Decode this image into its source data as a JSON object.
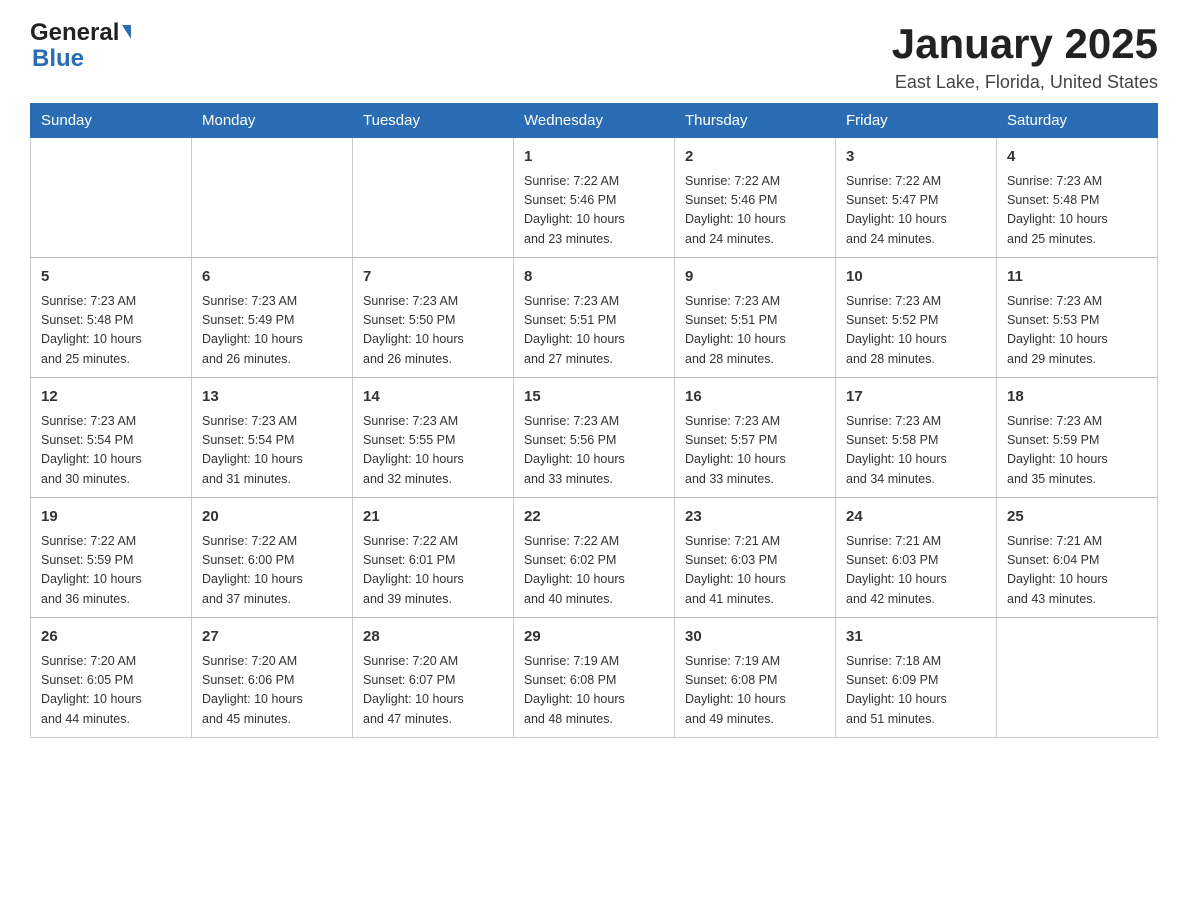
{
  "header": {
    "logo_general": "General",
    "logo_blue": "Blue",
    "month_title": "January 2025",
    "location": "East Lake, Florida, United States"
  },
  "weekdays": [
    "Sunday",
    "Monday",
    "Tuesday",
    "Wednesday",
    "Thursday",
    "Friday",
    "Saturday"
  ],
  "weeks": [
    [
      {
        "day": "",
        "info": ""
      },
      {
        "day": "",
        "info": ""
      },
      {
        "day": "",
        "info": ""
      },
      {
        "day": "1",
        "info": "Sunrise: 7:22 AM\nSunset: 5:46 PM\nDaylight: 10 hours\nand 23 minutes."
      },
      {
        "day": "2",
        "info": "Sunrise: 7:22 AM\nSunset: 5:46 PM\nDaylight: 10 hours\nand 24 minutes."
      },
      {
        "day": "3",
        "info": "Sunrise: 7:22 AM\nSunset: 5:47 PM\nDaylight: 10 hours\nand 24 minutes."
      },
      {
        "day": "4",
        "info": "Sunrise: 7:23 AM\nSunset: 5:48 PM\nDaylight: 10 hours\nand 25 minutes."
      }
    ],
    [
      {
        "day": "5",
        "info": "Sunrise: 7:23 AM\nSunset: 5:48 PM\nDaylight: 10 hours\nand 25 minutes."
      },
      {
        "day": "6",
        "info": "Sunrise: 7:23 AM\nSunset: 5:49 PM\nDaylight: 10 hours\nand 26 minutes."
      },
      {
        "day": "7",
        "info": "Sunrise: 7:23 AM\nSunset: 5:50 PM\nDaylight: 10 hours\nand 26 minutes."
      },
      {
        "day": "8",
        "info": "Sunrise: 7:23 AM\nSunset: 5:51 PM\nDaylight: 10 hours\nand 27 minutes."
      },
      {
        "day": "9",
        "info": "Sunrise: 7:23 AM\nSunset: 5:51 PM\nDaylight: 10 hours\nand 28 minutes."
      },
      {
        "day": "10",
        "info": "Sunrise: 7:23 AM\nSunset: 5:52 PM\nDaylight: 10 hours\nand 28 minutes."
      },
      {
        "day": "11",
        "info": "Sunrise: 7:23 AM\nSunset: 5:53 PM\nDaylight: 10 hours\nand 29 minutes."
      }
    ],
    [
      {
        "day": "12",
        "info": "Sunrise: 7:23 AM\nSunset: 5:54 PM\nDaylight: 10 hours\nand 30 minutes."
      },
      {
        "day": "13",
        "info": "Sunrise: 7:23 AM\nSunset: 5:54 PM\nDaylight: 10 hours\nand 31 minutes."
      },
      {
        "day": "14",
        "info": "Sunrise: 7:23 AM\nSunset: 5:55 PM\nDaylight: 10 hours\nand 32 minutes."
      },
      {
        "day": "15",
        "info": "Sunrise: 7:23 AM\nSunset: 5:56 PM\nDaylight: 10 hours\nand 33 minutes."
      },
      {
        "day": "16",
        "info": "Sunrise: 7:23 AM\nSunset: 5:57 PM\nDaylight: 10 hours\nand 33 minutes."
      },
      {
        "day": "17",
        "info": "Sunrise: 7:23 AM\nSunset: 5:58 PM\nDaylight: 10 hours\nand 34 minutes."
      },
      {
        "day": "18",
        "info": "Sunrise: 7:23 AM\nSunset: 5:59 PM\nDaylight: 10 hours\nand 35 minutes."
      }
    ],
    [
      {
        "day": "19",
        "info": "Sunrise: 7:22 AM\nSunset: 5:59 PM\nDaylight: 10 hours\nand 36 minutes."
      },
      {
        "day": "20",
        "info": "Sunrise: 7:22 AM\nSunset: 6:00 PM\nDaylight: 10 hours\nand 37 minutes."
      },
      {
        "day": "21",
        "info": "Sunrise: 7:22 AM\nSunset: 6:01 PM\nDaylight: 10 hours\nand 39 minutes."
      },
      {
        "day": "22",
        "info": "Sunrise: 7:22 AM\nSunset: 6:02 PM\nDaylight: 10 hours\nand 40 minutes."
      },
      {
        "day": "23",
        "info": "Sunrise: 7:21 AM\nSunset: 6:03 PM\nDaylight: 10 hours\nand 41 minutes."
      },
      {
        "day": "24",
        "info": "Sunrise: 7:21 AM\nSunset: 6:03 PM\nDaylight: 10 hours\nand 42 minutes."
      },
      {
        "day": "25",
        "info": "Sunrise: 7:21 AM\nSunset: 6:04 PM\nDaylight: 10 hours\nand 43 minutes."
      }
    ],
    [
      {
        "day": "26",
        "info": "Sunrise: 7:20 AM\nSunset: 6:05 PM\nDaylight: 10 hours\nand 44 minutes."
      },
      {
        "day": "27",
        "info": "Sunrise: 7:20 AM\nSunset: 6:06 PM\nDaylight: 10 hours\nand 45 minutes."
      },
      {
        "day": "28",
        "info": "Sunrise: 7:20 AM\nSunset: 6:07 PM\nDaylight: 10 hours\nand 47 minutes."
      },
      {
        "day": "29",
        "info": "Sunrise: 7:19 AM\nSunset: 6:08 PM\nDaylight: 10 hours\nand 48 minutes."
      },
      {
        "day": "30",
        "info": "Sunrise: 7:19 AM\nSunset: 6:08 PM\nDaylight: 10 hours\nand 49 minutes."
      },
      {
        "day": "31",
        "info": "Sunrise: 7:18 AM\nSunset: 6:09 PM\nDaylight: 10 hours\nand 51 minutes."
      },
      {
        "day": "",
        "info": ""
      }
    ]
  ]
}
